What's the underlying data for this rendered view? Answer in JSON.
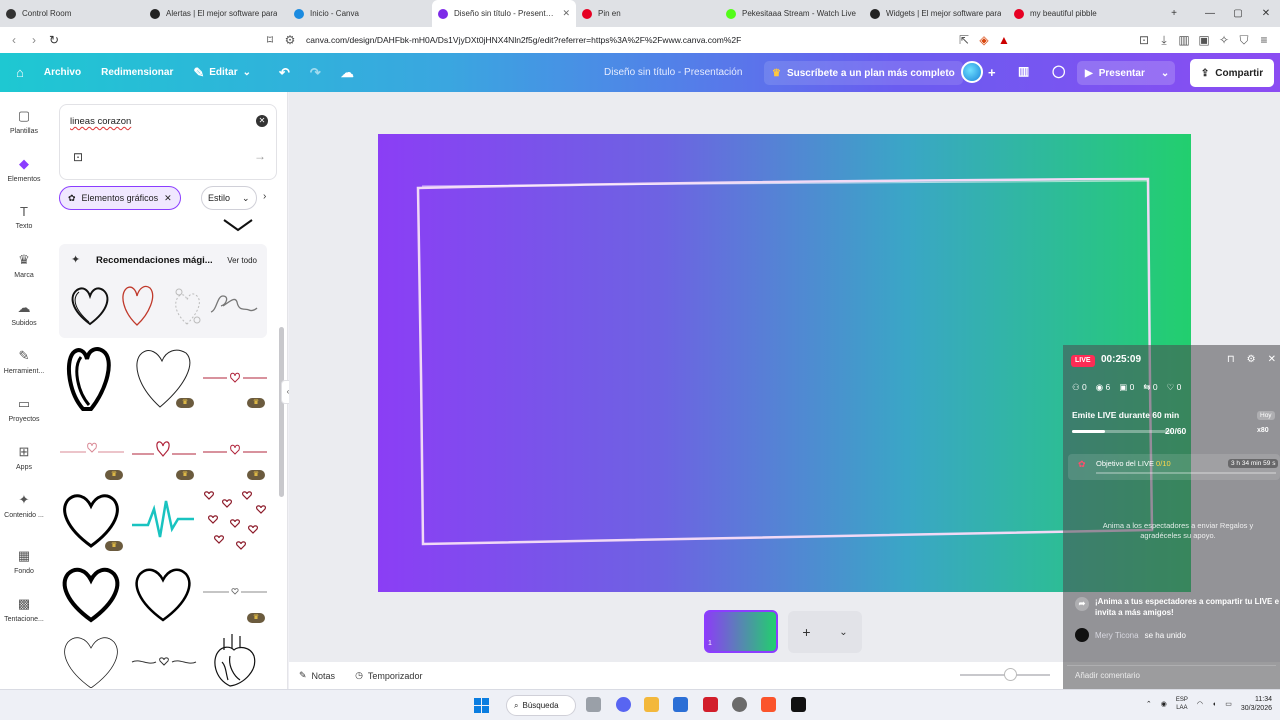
{
  "browser": {
    "tabs": [
      {
        "label": "Control Room",
        "color": "#333333",
        "active": false
      },
      {
        "label": "Alertas | El mejor software para",
        "color": "#222222",
        "active": false
      },
      {
        "label": "Inicio - Canva",
        "color": "#1b8be0",
        "active": false
      },
      {
        "label": "Diseño sin título - Presentació",
        "color": "#7d2ae8",
        "active": true
      },
      {
        "label": "Pin en",
        "color": "#e60023",
        "active": false
      },
      {
        "label": "Pekesitaaa Stream - Watch Live",
        "color": "#53fc18",
        "active": false
      },
      {
        "label": "Widgets | El mejor software para",
        "color": "#222222",
        "active": false
      },
      {
        "label": "my beautiful pibble",
        "color": "#e60023",
        "active": false
      }
    ],
    "new_tab": "+",
    "url": "canva.com/design/DAHFbk-mH0A/Ds1VjyDXt0jHNX4Nln2f5g/edit?referrer=https%3A%2F%2Fwww.canva.com%2F"
  },
  "canva_header": {
    "file_label": "Archivo",
    "resize_label": "Redimensionar",
    "edit_label": "Editar",
    "design_title": "Diseño sin título - Presentación",
    "subscribe_label": "Suscríbete a un plan más completo",
    "present_label": "Presentar",
    "share_label": "Compartir"
  },
  "rail": {
    "items": [
      {
        "label": "Plantillas",
        "icon": "▢"
      },
      {
        "label": "Elementos",
        "icon": "◆"
      },
      {
        "label": "Texto",
        "icon": "T"
      },
      {
        "label": "Marca",
        "icon": "♛"
      },
      {
        "label": "Subidos",
        "icon": "☁"
      },
      {
        "label": "Herramient...",
        "icon": "✎"
      },
      {
        "label": "Proyectos",
        "icon": "▭"
      },
      {
        "label": "Apps",
        "icon": "⊞"
      },
      {
        "label": "Contenido ...",
        "icon": "✦"
      },
      {
        "label": "Fondo",
        "icon": "▦"
      },
      {
        "label": "Tentacione...",
        "icon": "▩"
      }
    ]
  },
  "panel": {
    "search_value": "lineas corazon",
    "filter_chip": "Elementos gráficos",
    "style_chip": "Estilo",
    "reco_title": "Recomendaciones mági...",
    "view_all": "Ver todo"
  },
  "editor": {
    "page_number": "1",
    "notes_label": "Notas",
    "timer_label": "Temporizador"
  },
  "live_overlay": {
    "badge": "LIVE",
    "timer": "00:25:09",
    "stats": [
      {
        "icon": "people",
        "value": "0"
      },
      {
        "icon": "eye",
        "value": "6"
      },
      {
        "icon": "gift",
        "value": "0"
      },
      {
        "icon": "share",
        "value": "0"
      },
      {
        "icon": "heart",
        "value": "0"
      }
    ],
    "goal_label": "Emite LIVE durante 60 min",
    "goal_progress": "20/60",
    "goal_fraction": 0.33,
    "side_tag": "Hoy",
    "side_count": "x80",
    "objective_label": "Objetivo del LIVE",
    "objective_value": "0/10",
    "objective_time": "3 h 34 min 59 s",
    "empty_hint": "Anima a los espectadores a enviar Regalos y agradéceles su apoyo.",
    "share_cta": "¡Anima a tus espectadores a compartir tu LIVE e invita a más amigos!",
    "joined_user": "Mery Ticona",
    "joined_text": "se ha unido",
    "comment_placeholder": "Añadir comentario"
  },
  "taskbar": {
    "search_label": "Búsqueda",
    "lang_top": "ESP",
    "lang_bottom": "LAA",
    "time": "11:34",
    "date": "30/3/2026"
  }
}
